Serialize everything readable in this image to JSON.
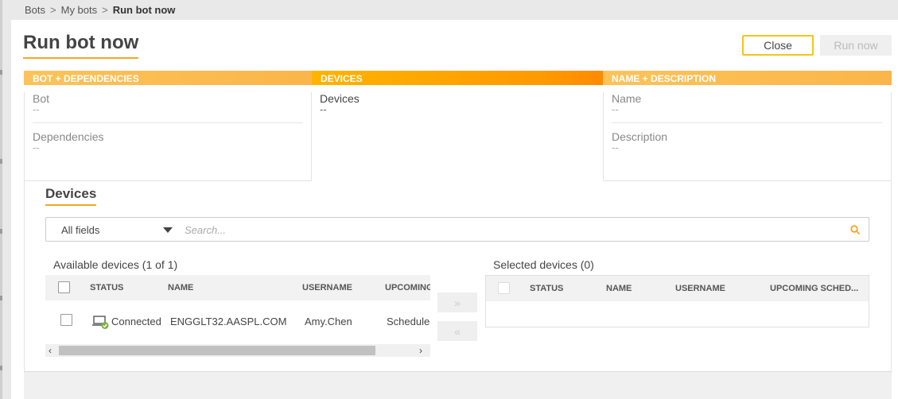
{
  "breadcrumb": {
    "items": [
      "Bots",
      "My bots"
    ],
    "separator": ">",
    "current": "Run bot now"
  },
  "page": {
    "title": "Run bot now"
  },
  "actions": {
    "close_label": "Close",
    "run_label": "Run now"
  },
  "steps": [
    {
      "header": "BOT + DEPENDENCIES",
      "fields": [
        {
          "label": "Bot",
          "value": "--"
        },
        {
          "label": "Dependencies",
          "value": "--"
        }
      ]
    },
    {
      "header": "DEVICES",
      "fields": [
        {
          "label": "Devices",
          "value": "--"
        }
      ]
    },
    {
      "header": "NAME + DESCRIPTION",
      "fields": [
        {
          "label": "Name",
          "value": "--"
        },
        {
          "label": "Description",
          "value": "--"
        }
      ]
    }
  ],
  "devices_section": {
    "title": "Devices",
    "filter": {
      "selected": "All fields",
      "placeholder": "Search..."
    },
    "available": {
      "label": "Available devices (1 of 1)",
      "columns": [
        "STATUS",
        "NAME",
        "USERNAME",
        "UPCOMING"
      ],
      "rows": [
        {
          "status": "Connected",
          "name": "ENGGLT32.AASPL.COM",
          "username": "Amy.Chen",
          "upcoming": "Scheduled"
        }
      ]
    },
    "selected": {
      "label": "Selected devices (0)",
      "columns": [
        "STATUS",
        "NAME",
        "USERNAME",
        "UPCOMING SCHED..."
      ]
    },
    "move_right": "»",
    "move_left": "«"
  },
  "colors": {
    "accent": "#f5a623",
    "close_border": "#f5c518",
    "connected": "#7cb342"
  },
  "icons": {
    "search": "search-icon",
    "dropdown": "chevron-down-icon",
    "device": "laptop-connected-icon"
  }
}
